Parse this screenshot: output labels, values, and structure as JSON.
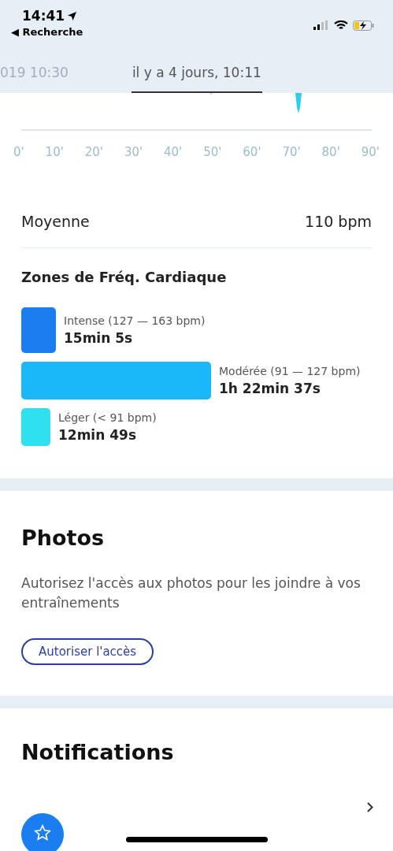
{
  "status_bar": {
    "time": "14:41",
    "back_label": "◀ Recherche"
  },
  "tabs": [
    {
      "label": "019 10:30",
      "selected": false
    },
    {
      "label": "il y a 4 jours, 10:11",
      "selected": true
    }
  ],
  "chart": {
    "x_labels": [
      "0'",
      "10'",
      "20'",
      "30'",
      "40'",
      "50'",
      "60'",
      "70'",
      "80'",
      "90'"
    ]
  },
  "average": {
    "label": "Moyenne",
    "value": "110 bpm"
  },
  "zones": {
    "title": "Zones de Fréq. Cardiaque",
    "items": [
      {
        "label": "Intense (127 — 163 bpm)",
        "duration": "15min 5s",
        "color": "#1a7ef0"
      },
      {
        "label": "Modérée (91 — 127 bpm)",
        "duration": "1h 22min 37s",
        "color": "#1bb8f7"
      },
      {
        "label": "Léger (< 91 bpm)",
        "duration": "12min 49s",
        "color": "#2ee0f0"
      }
    ]
  },
  "photos": {
    "title": "Photos",
    "text": "Autorisez l'accès aux photos pour les joindre à vos entraînements",
    "button": "Autoriser l'accès"
  },
  "notifications": {
    "title": "Notifications"
  }
}
